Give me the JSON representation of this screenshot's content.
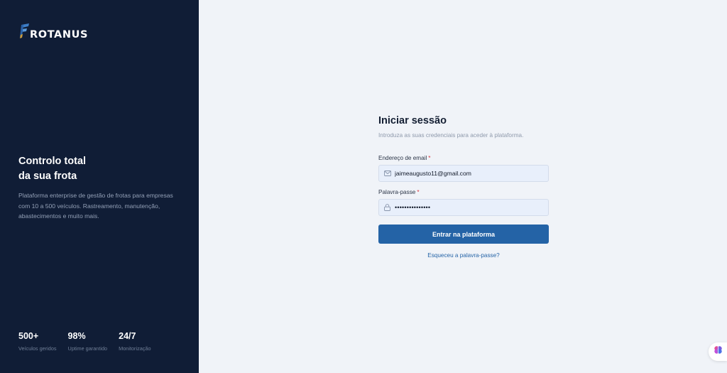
{
  "brand": {
    "name": "ROTANUS",
    "icon": "f-logo-icon"
  },
  "hero": {
    "title_line1": "Controlo total",
    "title_line2": "da sua frota",
    "description": "Plataforma enterprise de gestão de frotas para empresas com 10 a 500 veículos. Rastreamento, manutenção, abastecimentos e muito mais."
  },
  "stats": [
    {
      "value": "500+",
      "label": "Veículos geridos"
    },
    {
      "value": "98%",
      "label": "Uptime garantido"
    },
    {
      "value": "24/7",
      "label": "Monitorização"
    }
  ],
  "login": {
    "title": "Iniciar sessão",
    "subtitle": "Introduza as suas credenciais para aceder à plataforma.",
    "email_label": "Endereço de email",
    "email_value": "jaimeaugusto11@gmail.com",
    "email_icon": "mail-icon",
    "password_label": "Palavra-passe",
    "password_value": "•••••••••••••••",
    "password_icon": "lock-icon",
    "required_mark": "*",
    "submit_label": "Entrar na plataforma",
    "forgot_label": "Esqueceu a palavra-passe?"
  },
  "colors": {
    "sidebar_bg": "#101d36",
    "page_bg": "#f0f3f8",
    "accent": "#2463a6",
    "required": "#d9363e"
  },
  "widget": {
    "icon": "brain-icon"
  }
}
